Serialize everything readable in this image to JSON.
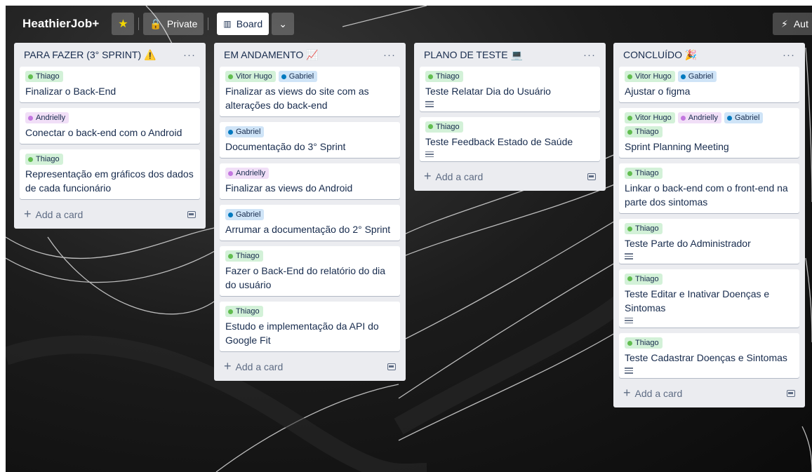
{
  "header": {
    "board_title": "HeathierJob+",
    "visibility_label": "Private",
    "view_label": "Board",
    "automation_label": "Aut"
  },
  "colors": {
    "green": "#d3f1d8",
    "green_dot": "#61bd4f",
    "blue": "#cfe4f7",
    "blue_dot": "#0079bf",
    "purple": "#f1dff7",
    "purple_dot": "#c377e0",
    "list_bg": "#ebecf0"
  },
  "lists": [
    {
      "title": "PARA FAZER (3° SPRINT) ⚠️",
      "add_label": "Add a card",
      "cards": [
        {
          "labels": [
            {
              "text": "Thiago",
              "color": "green"
            }
          ],
          "title": "Finalizar o Back-End",
          "has_desc": false
        },
        {
          "labels": [
            {
              "text": "Andrielly",
              "color": "purple"
            }
          ],
          "title": "Conectar o back-end com o Android",
          "has_desc": false
        },
        {
          "labels": [
            {
              "text": "Thiago",
              "color": "green"
            }
          ],
          "title": "Representação em gráficos dos dados de cada funcionário",
          "has_desc": false
        }
      ]
    },
    {
      "title": "EM ANDAMENTO 📈",
      "add_label": "Add a card",
      "cards": [
        {
          "labels": [
            {
              "text": "Vitor Hugo",
              "color": "green"
            },
            {
              "text": "Gabriel",
              "color": "blue"
            }
          ],
          "title": "Finalizar as views do site com as alterações do back-end",
          "has_desc": false
        },
        {
          "labels": [
            {
              "text": "Gabriel",
              "color": "blue"
            }
          ],
          "title": "Documentação do 3° Sprint",
          "has_desc": false
        },
        {
          "labels": [
            {
              "text": "Andrielly",
              "color": "purple"
            }
          ],
          "title": "Finalizar as views do Android",
          "has_desc": false
        },
        {
          "labels": [
            {
              "text": "Gabriel",
              "color": "blue"
            }
          ],
          "title": "Arrumar a documentação do 2° Sprint",
          "has_desc": false
        },
        {
          "labels": [
            {
              "text": "Thiago",
              "color": "green"
            }
          ],
          "title": "Fazer o Back-End do relatório do dia do usuário",
          "has_desc": false
        },
        {
          "labels": [
            {
              "text": "Thiago",
              "color": "green"
            }
          ],
          "title": "Estudo e implementação da API do Google Fit",
          "has_desc": false
        }
      ]
    },
    {
      "title": "PLANO DE TESTE 💻",
      "add_label": "Add a card",
      "cards": [
        {
          "labels": [
            {
              "text": "Thiago",
              "color": "green"
            }
          ],
          "title": "Teste Relatar Dia do Usuário",
          "has_desc": true
        },
        {
          "labels": [
            {
              "text": "Thiago",
              "color": "green"
            }
          ],
          "title": "Teste Feedback Estado de Saúde",
          "has_desc": true
        }
      ]
    },
    {
      "title": "CONCLUÍDO 🎉",
      "add_label": "Add a card",
      "cards": [
        {
          "labels": [
            {
              "text": "Vitor Hugo",
              "color": "green"
            },
            {
              "text": "Gabriel",
              "color": "blue"
            }
          ],
          "title": "Ajustar o figma",
          "has_desc": false
        },
        {
          "labels": [
            {
              "text": "Vitor Hugo",
              "color": "green"
            },
            {
              "text": "Andrielly",
              "color": "purple"
            },
            {
              "text": "Gabriel",
              "color": "blue"
            },
            {
              "text": "Thiago",
              "color": "green"
            }
          ],
          "title": "Sprint Planning Meeting",
          "has_desc": false
        },
        {
          "labels": [
            {
              "text": "Thiago",
              "color": "green"
            }
          ],
          "title": "Linkar o back-end com o front-end na parte dos sintomas",
          "has_desc": false
        },
        {
          "labels": [
            {
              "text": "Thiago",
              "color": "green"
            }
          ],
          "title": "Teste Parte do Administrador",
          "has_desc": true
        },
        {
          "labels": [
            {
              "text": "Thiago",
              "color": "green"
            }
          ],
          "title": "Teste Editar e Inativar Doenças e Sintomas",
          "has_desc": true
        },
        {
          "labels": [
            {
              "text": "Thiago",
              "color": "green"
            }
          ],
          "title": "Teste Cadastrar Doenças e Sintomas",
          "has_desc": true
        }
      ]
    }
  ]
}
